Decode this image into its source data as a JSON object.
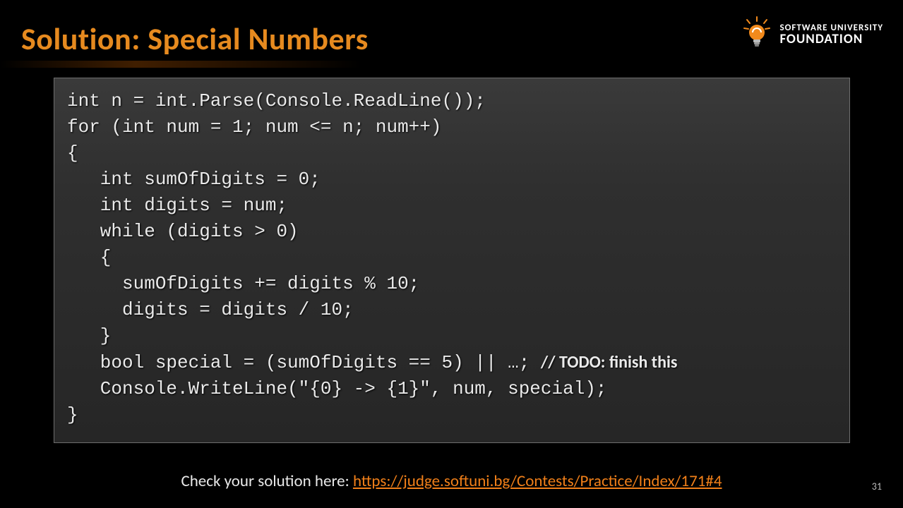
{
  "title": "Solution: Special Numbers",
  "logo": {
    "line1": "SOFTWARE UNIVERSITY",
    "line2": "FOUNDATION"
  },
  "code": {
    "l1": "int n = int.Parse(Console.ReadLine());",
    "l2": "for (int num = 1; num <= n; num++)",
    "l3": "{",
    "l4": "   int sumOfDigits = 0;",
    "l5": "   int digits = num;",
    "l6": "   while (digits > 0)",
    "l7": "   {",
    "l8": "     sumOfDigits += digits % 10;",
    "l9": "     digits = digits / 10;",
    "l10": "   }",
    "l11a": "   bool special = (sumOfDigits == 5) || …; ",
    "l11b": "// TODO: finish this",
    "l12": "   Console.WriteLine(\"{0} -> {1}\", num, special);",
    "l13": "}"
  },
  "footer": {
    "prefix": "Check your solution here: ",
    "link_text": "https://judge.softuni.bg/Contests/Practice/Index/171#4",
    "link_href": "https://judge.softuni.bg/Contests/Practice/Index/171#4"
  },
  "page_number": "31"
}
